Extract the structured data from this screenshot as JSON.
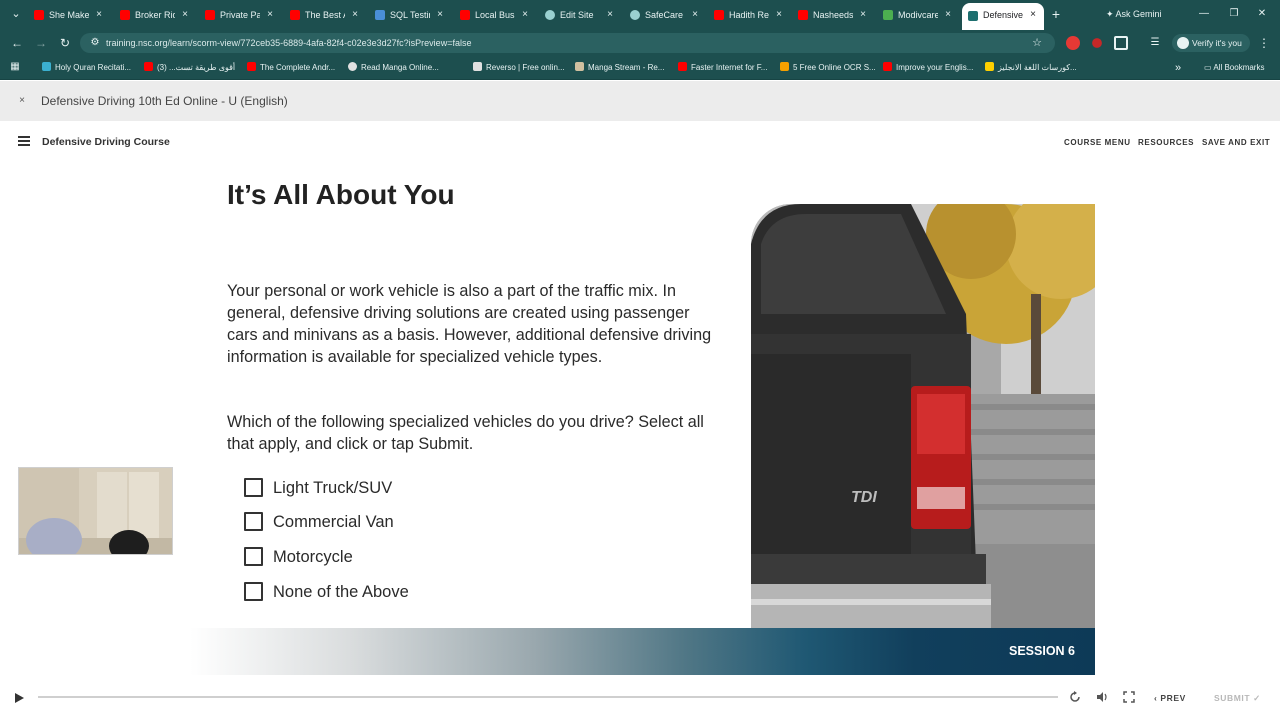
{
  "browser": {
    "tabs": [
      {
        "title": "She Makes",
        "favicon": "youtube-icon",
        "color": "#ff0000"
      },
      {
        "title": "Broker Rid",
        "favicon": "youtube-icon",
        "color": "#ff0000"
      },
      {
        "title": "Private Pay",
        "favicon": "youtube-icon",
        "color": "#ff0000"
      },
      {
        "title": "The Best A",
        "favicon": "youtube-icon",
        "color": "#ff0000"
      },
      {
        "title": "SQL Testin",
        "favicon": "sql-icon",
        "color": "#4a8fd8"
      },
      {
        "title": "Local Busi",
        "favicon": "youtube-icon",
        "color": "#ff0000"
      },
      {
        "title": "Edit Site",
        "favicon": "globe-icon",
        "color": "#9ad0d0"
      },
      {
        "title": "SafeCare T",
        "favicon": "globe-icon",
        "color": "#9ad0d0"
      },
      {
        "title": "Hadith Re",
        "favicon": "youtube-icon",
        "color": "#ff0000"
      },
      {
        "title": "Nasheeds",
        "favicon": "youtube-icon",
        "color": "#ff0000"
      },
      {
        "title": "Modivcare",
        "favicon": "modivcare-icon",
        "color": "#4caf50"
      },
      {
        "title": "Defensive",
        "favicon": "nsc-icon",
        "color": "#1d6f6f",
        "active": true
      }
    ],
    "ask_gemini": "Ask Gemini",
    "url": "training.nsc.org/learn/scorm-view/772ceb35-6889-4afa-82f4-c02e3e3d27fc?isPreview=false",
    "verify_label": "Verify it's you",
    "bookmarks": [
      {
        "label": "Holy Quran Recitati...",
        "color": "#3bb0d0"
      },
      {
        "label": "أقوى طريقة تست... (3)",
        "color": "#ff0000"
      },
      {
        "label": "The Complete Andr...",
        "color": "#ff0000"
      },
      {
        "label": "Read Manga Online...",
        "color": "#e0e0e0"
      },
      {
        "label": "Reverso | Free onlin...",
        "color": "#e0e0e0"
      },
      {
        "label": "Manga Stream - Re...",
        "color": "#d0c0a0"
      },
      {
        "label": "Faster Internet for F...",
        "color": "#ff0000"
      },
      {
        "label": "5 Free Online OCR S...",
        "color": "#f4a000"
      },
      {
        "label": "Improve your Englis...",
        "color": "#ff0000"
      },
      {
        "label": "كورسات اللغة الانجليز...",
        "color": "#ffd000"
      }
    ],
    "all_bookmarks": "All Bookmarks"
  },
  "course_bar": {
    "close": "×",
    "title": "Defensive Driving 10th Ed Online - U (English)"
  },
  "header": {
    "title": "Defensive Driving Course",
    "course_menu": "COURSE MENU",
    "resources": "RESOURCES",
    "save_exit": "SAVE AND EXIT"
  },
  "lesson": {
    "heading": "It’s All About You",
    "paragraph1": "Your personal or work vehicle is also a part of the traffic mix. In general, defensive driving solutions are created using passenger cars and minivans as a basis. However, additional defensive driving information is available for specialized vehicle types.",
    "paragraph2": "Which of the following specialized vehicles do you drive? Select all that apply, and click or tap Submit.",
    "options": [
      {
        "label": "Light Truck/SUV",
        "checked": false
      },
      {
        "label": "Commercial Van",
        "checked": false
      },
      {
        "label": "Motorcycle",
        "checked": false
      },
      {
        "label": "None of the Above",
        "checked": false
      }
    ],
    "image_badge": "TDI",
    "session_label": "SESSION 6"
  },
  "player": {
    "progress": 0.0,
    "prev_label": "PREV",
    "submit_label": "SUBMIT",
    "progress_color": "#2e7d4f"
  }
}
